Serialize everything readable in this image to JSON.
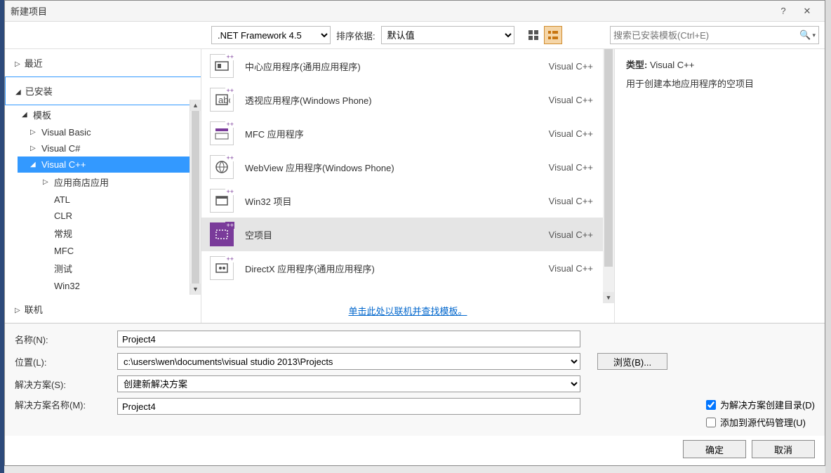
{
  "dialog": {
    "title": "新建项目",
    "help": "?",
    "close": "✕"
  },
  "topbar": {
    "framework": ".NET Framework 4.5",
    "sort_label": "排序依据:",
    "sort_value": "默认值",
    "search_placeholder": "搜索已安装模板(Ctrl+E)"
  },
  "nav": {
    "recent": "最近",
    "installed": "已安装",
    "online": "联机",
    "templates": "模板",
    "vb": "Visual Basic",
    "vcs": "Visual C#",
    "vcpp": "Visual C++",
    "store": "应用商店应用",
    "atl": "ATL",
    "clr": "CLR",
    "general": "常规",
    "mfc": "MFC",
    "test": "测试",
    "win32": "Win32"
  },
  "templates": [
    {
      "name": "中心应用程序(通用应用程序)",
      "lang": "Visual C++"
    },
    {
      "name": "透视应用程序(Windows Phone)",
      "lang": "Visual C++"
    },
    {
      "name": "MFC 应用程序",
      "lang": "Visual C++"
    },
    {
      "name": "WebView 应用程序(Windows Phone)",
      "lang": "Visual C++"
    },
    {
      "name": "Win32 项目",
      "lang": "Visual C++"
    },
    {
      "name": "空项目",
      "lang": "Visual C++",
      "selected": true
    },
    {
      "name": "DirectX 应用程序(通用应用程序)",
      "lang": "Visual C++"
    }
  ],
  "online_link": "单击此处以联机并查找模板。",
  "desc": {
    "type_label": "类型:",
    "type_value": "Visual C++",
    "text": "用于创建本地应用程序的空项目"
  },
  "form": {
    "name_label": "名称(N):",
    "name_value": "Project4",
    "location_label": "位置(L):",
    "location_value": "c:\\users\\wen\\documents\\visual studio 2013\\Projects",
    "browse": "浏览(B)...",
    "solution_label": "解决方案(S):",
    "solution_value": "创建新解决方案",
    "solname_label": "解决方案名称(M):",
    "solname_value": "Project4",
    "chk_createdir": "为解决方案创建目录(D)",
    "chk_addsource": "添加到源代码管理(U)"
  },
  "buttons": {
    "ok": "确定",
    "cancel": "取消"
  }
}
